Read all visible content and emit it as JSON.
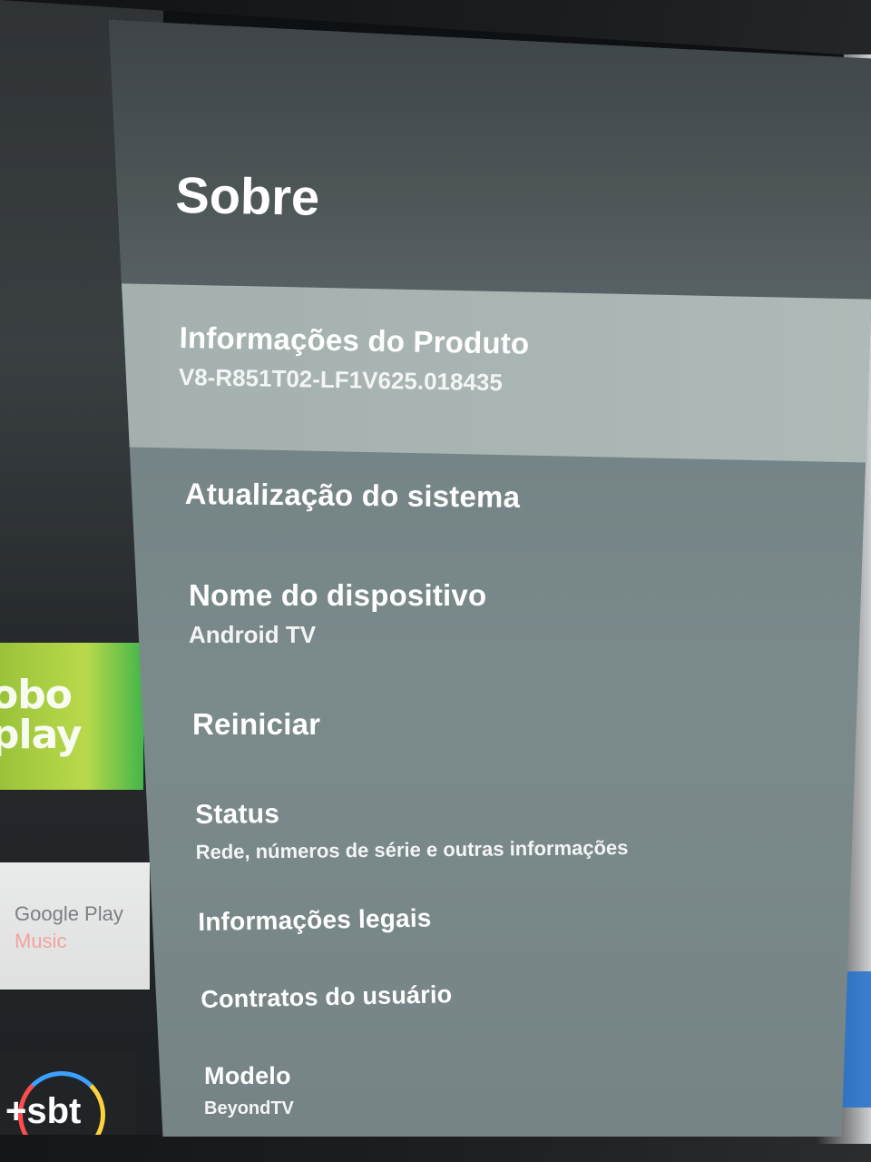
{
  "panel": {
    "title": "Sobre",
    "items": [
      {
        "label": "Informações do Produto",
        "value": "V8-R851T02-LF1V625.018435",
        "selected": true
      },
      {
        "label": "Atualização do sistema"
      },
      {
        "label": "Nome do dispositivo",
        "value": "Android TV"
      },
      {
        "label": "Reiniciar"
      },
      {
        "label": "Status",
        "value": "Rede, números de série e outras informações"
      },
      {
        "label": "Informações legais"
      },
      {
        "label": "Contratos do usuário"
      },
      {
        "label": "Modelo",
        "value": "BeyondTV"
      }
    ]
  },
  "home_tiles": {
    "globoplay": {
      "text": "obo\nplay"
    },
    "google_play_music": {
      "title": "Google Play",
      "subtitle": "Music"
    },
    "sbt": {
      "text": "+sbt"
    }
  },
  "colors": {
    "panel_bg": "#7b8a8b",
    "panel_header": "#4d5557",
    "selected_row": "#aebab7",
    "text": "#ffffff",
    "globoplay_green": "#9ac33a"
  }
}
